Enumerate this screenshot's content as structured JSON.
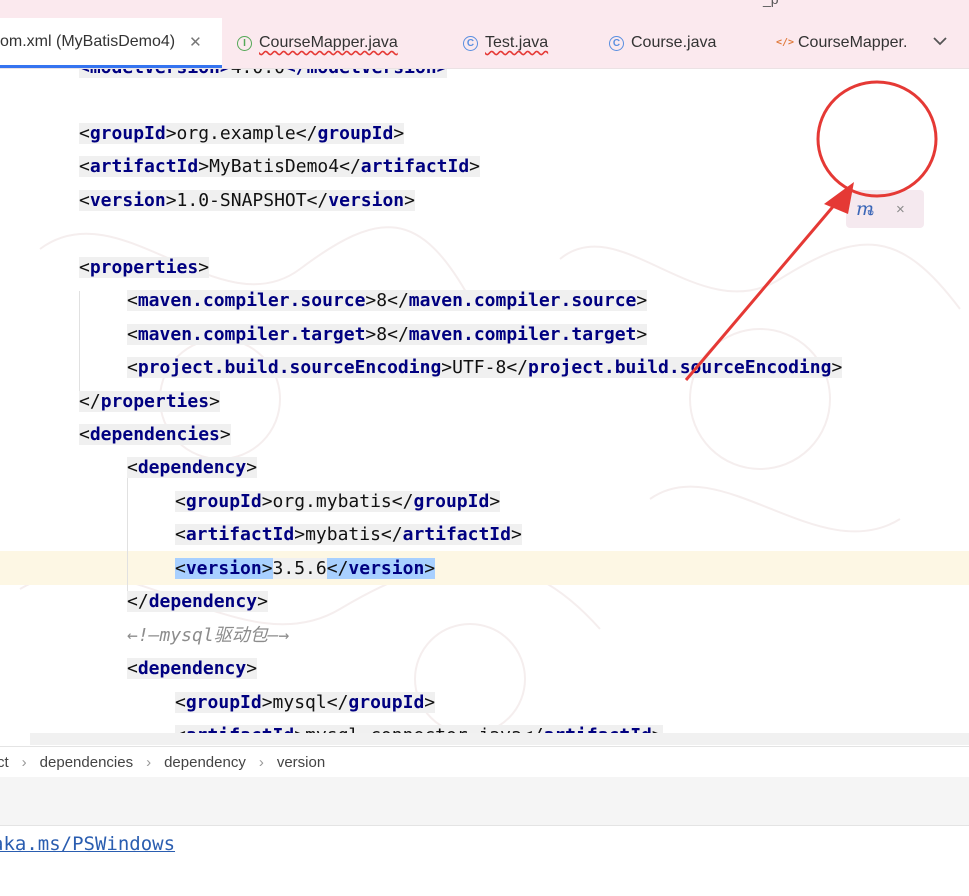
{
  "tabs": [
    {
      "label": "om.xml (MyBatisDemo4)",
      "icon": "none",
      "active": true
    },
    {
      "label": "CourseMapper.java",
      "icon": "interface-icon",
      "error": true
    },
    {
      "label": "Test.java",
      "icon": "class-icon",
      "error": true
    },
    {
      "label": "Course.java",
      "icon": "class-icon"
    },
    {
      "label": "CourseMapper.",
      "icon": "xml-icon"
    }
  ],
  "top_strip_text": "_p",
  "code": {
    "partial_first": {
      "open": "<modelVersion>",
      "text": "4.0.0",
      "close": "</modelVersion>"
    },
    "lines": [
      {
        "open": "groupId",
        "text": "org.example"
      },
      {
        "open": "artifactId",
        "text": "MyBatisDemo4"
      },
      {
        "open": "version",
        "text": "1.0-SNAPSHOT"
      },
      {
        "open": "properties"
      },
      {
        "open": "maven.compiler.source",
        "text": "8"
      },
      {
        "open": "maven.compiler.target",
        "text": "8"
      },
      {
        "open": "project.build.sourceEncoding",
        "text": "UTF-8"
      },
      {
        "close": "properties"
      },
      {
        "open": "dependencies"
      },
      {
        "open": "dependency"
      },
      {
        "open": "groupId",
        "text": "org.mybatis"
      },
      {
        "open": "artifactId",
        "text": "mybatis"
      },
      {
        "open": "version",
        "text": "3.5.6"
      },
      {
        "close": "dependency"
      },
      {
        "comment": "←!—mysql驱动包—→"
      },
      {
        "open": "dependency"
      },
      {
        "open": "groupId",
        "text": "mysql"
      },
      {
        "open": "artifactId",
        "text": "mysql-connector-java"
      }
    ]
  },
  "maven_popup": {
    "icon": "maven-reload-icon",
    "close": "×"
  },
  "breadcrumbs": [
    "ct",
    "dependencies",
    "dependency",
    "version"
  ],
  "footer_link": "aka.ms/PSWindows",
  "colors": {
    "tag": "#000080",
    "highlight": "#a8d0ff",
    "annotation": "#e53935",
    "tabbar": "#fbe9ee"
  }
}
